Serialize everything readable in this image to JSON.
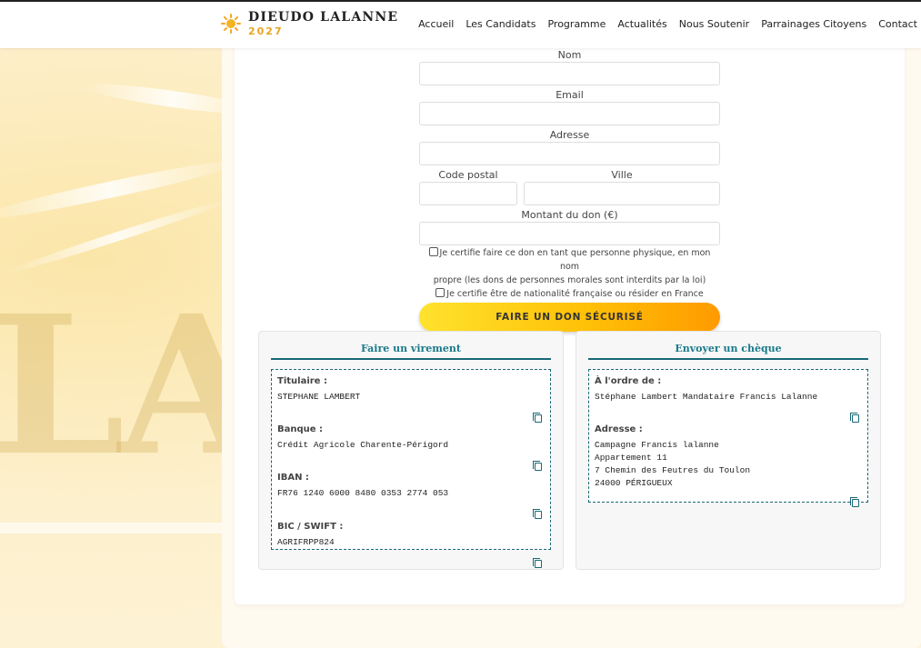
{
  "brand": {
    "name": "DIEUDO LALANNE",
    "year": "2027",
    "accent": "#e8a321"
  },
  "nav": [
    {
      "label": "Accueil"
    },
    {
      "label": "Les Candidats"
    },
    {
      "label": "Programme"
    },
    {
      "label": "Actualités"
    },
    {
      "label": "Nous Soutenir"
    },
    {
      "label": "Parrainages Citoyens"
    },
    {
      "label": "Contact"
    }
  ],
  "form": {
    "nom_label": "Nom",
    "email_label": "Email",
    "adresse_label": "Adresse",
    "code_postal_label": "Code postal",
    "ville_label": "Ville",
    "montant_label": "Montant du don (€)",
    "certify_1_line1": "Je certifie faire ce don en tant que personne physique, en mon nom",
    "certify_1_line2": "propre (les dons de personnes morales sont interdits par la loi)",
    "certify_2": "Je certifie être de nationalité française ou résider en France",
    "submit_label": "FAIRE UN DON SÉCURISÉ"
  },
  "virement": {
    "title": "Faire un virement",
    "titulaire_label": "Titulaire :",
    "titulaire_value": "STEPHANE LAMBERT",
    "banque_label": "Banque :",
    "banque_value": "Crédit Agricole Charente-Périgord",
    "iban_label": "IBAN :",
    "iban_value": "FR76 1240 6000 8480 0353 2774 053",
    "bic_label": "BIC / SWIFT :",
    "bic_value": "AGRIFRPP824"
  },
  "cheque": {
    "title": "Envoyer un chèque",
    "ordre_label": "À l'ordre de :",
    "ordre_value": "Stéphane Lambert Mandataire Francis Lalanne",
    "adresse_label": "Adresse :",
    "adresse_line1": "Campagne Francis lalanne",
    "adresse_line2": "Appartement 11",
    "adresse_line3": "7 Chemin des Feutres du Toulon",
    "adresse_line4": "24000 PÉRIGUEUX"
  },
  "background": {
    "letters": "LA"
  }
}
